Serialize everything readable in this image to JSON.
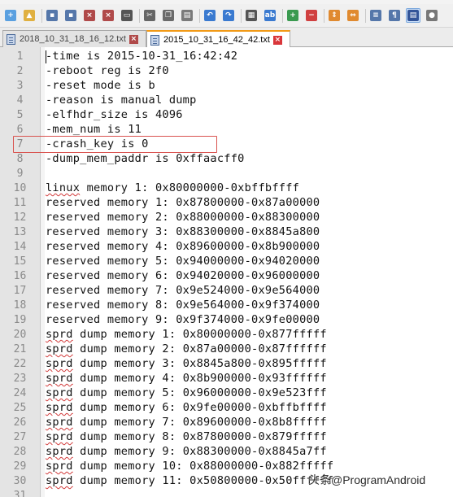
{
  "tabs": [
    {
      "label": "2018_10_31_18_16_12.txt",
      "active": false
    },
    {
      "label": "2015_10_31_16_42_42.txt",
      "active": true
    }
  ],
  "toolbar_icons": [
    "new-file-icon",
    "open-file-icon",
    "save-icon",
    "save-all-icon",
    "close-icon",
    "close-all-icon",
    "print-icon",
    "cut-icon",
    "copy-icon",
    "paste-icon",
    "undo-icon",
    "redo-icon",
    "find-icon",
    "replace-icon",
    "zoom-in-icon",
    "zoom-out-icon",
    "sync-vertical-icon",
    "sync-horizontal-icon",
    "word-wrap-icon",
    "show-all-chars-icon",
    "indent-guide-icon",
    "macro-record-icon"
  ],
  "lines": [
    {
      "n": "1",
      "text": "-time is 2015-10-31_16:42:42"
    },
    {
      "n": "2",
      "text": "-reboot reg is 2f0"
    },
    {
      "n": "3",
      "text": "-reset mode is b"
    },
    {
      "n": "4",
      "text": "-reason is manual dump"
    },
    {
      "n": "5",
      "text": "-elfhdr_size is 4096"
    },
    {
      "n": "6",
      "text": "-mem_num is 11"
    },
    {
      "n": "7",
      "text": "-crash_key is 0"
    },
    {
      "n": "8",
      "text": "-dump_mem_paddr is 0xffaacff0"
    },
    {
      "n": "9",
      "text": ""
    },
    {
      "n": "10",
      "text": "linux memory 1: 0x80000000-0xbffbffff",
      "squiggle": "linux"
    },
    {
      "n": "11",
      "text": "reserved memory 1: 0x87800000-0x87a00000"
    },
    {
      "n": "12",
      "text": "reserved memory 2: 0x88000000-0x88300000"
    },
    {
      "n": "13",
      "text": "reserved memory 3: 0x88300000-0x8845a800"
    },
    {
      "n": "14",
      "text": "reserved memory 4: 0x89600000-0x8b900000"
    },
    {
      "n": "15",
      "text": "reserved memory 5: 0x94000000-0x94020000"
    },
    {
      "n": "16",
      "text": "reserved memory 6: 0x94020000-0x96000000"
    },
    {
      "n": "17",
      "text": "reserved memory 7: 0x9e524000-0x9e564000"
    },
    {
      "n": "18",
      "text": "reserved memory 8: 0x9e564000-0x9f374000"
    },
    {
      "n": "19",
      "text": "reserved memory 9: 0x9f374000-0x9fe00000"
    },
    {
      "n": "20",
      "text": "sprd dump memory 1: 0x80000000-0x877fffff",
      "squiggle": "sprd"
    },
    {
      "n": "21",
      "text": "sprd dump memory 2: 0x87a00000-0x87ffffff",
      "squiggle": "sprd"
    },
    {
      "n": "22",
      "text": "sprd dump memory 3: 0x8845a800-0x895fffff",
      "squiggle": "sprd"
    },
    {
      "n": "23",
      "text": "sprd dump memory 4: 0x8b900000-0x93ffffff",
      "squiggle": "sprd"
    },
    {
      "n": "24",
      "text": "sprd dump memory 5: 0x96000000-0x9e523fff",
      "squiggle": "sprd"
    },
    {
      "n": "25",
      "text": "sprd dump memory 6: 0x9fe00000-0xbffbffff",
      "squiggle": "sprd"
    },
    {
      "n": "26",
      "text": "sprd dump memory 7: 0x89600000-0x8b8fffff",
      "squiggle": "sprd"
    },
    {
      "n": "27",
      "text": "sprd dump memory 8: 0x87800000-0x879fffff",
      "squiggle": "sprd"
    },
    {
      "n": "28",
      "text": "sprd dump memory 9: 0x88300000-0x8845a7ff",
      "squiggle": "sprd"
    },
    {
      "n": "29",
      "text": "sprd dump memory 10: 0x88000000-0x882fffff",
      "squiggle": "sprd"
    },
    {
      "n": "30",
      "text": "sprd dump memory 11: 0x50800000-0x50ffffff",
      "squiggle": "sprd"
    },
    {
      "n": "31",
      "text": ""
    }
  ],
  "watermark": "头条@ProgramAndroid",
  "colors": {
    "highlight_box": "#d9534f",
    "active_tab_accent": "#f29a16",
    "gutter": "#e4e4e4",
    "line_number": "#8a8a8a"
  }
}
